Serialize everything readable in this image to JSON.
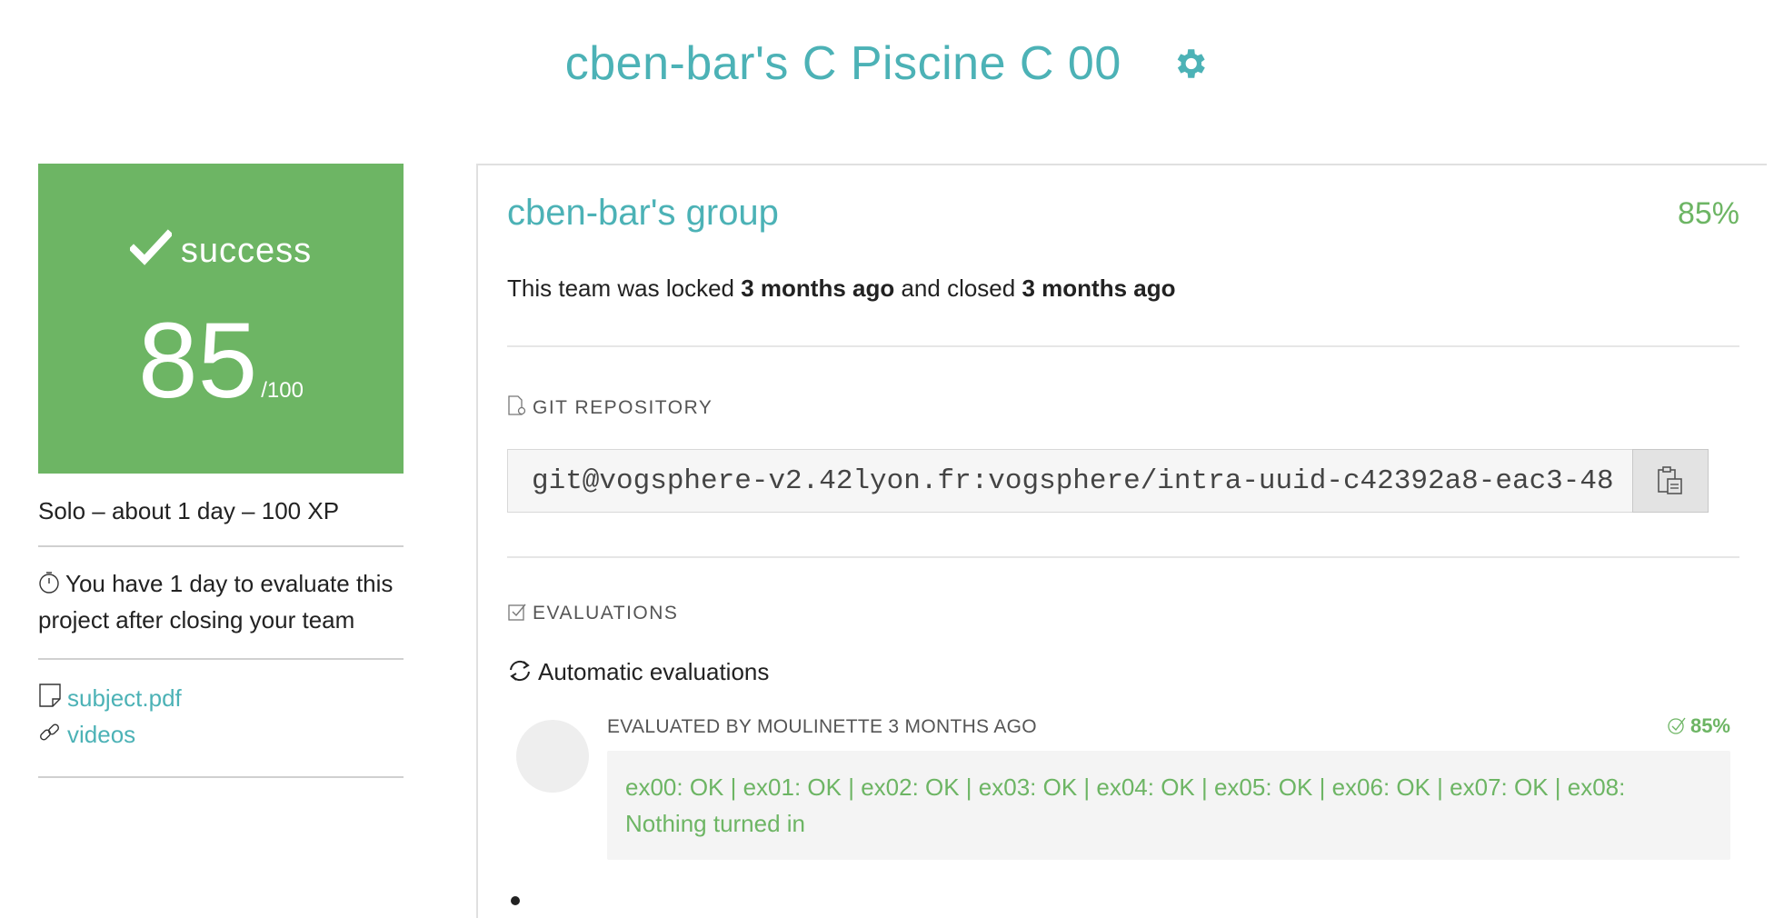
{
  "header": {
    "title": "cben-bar's C Piscine C 00",
    "settings_icon": "gear-icon",
    "accent_color": "#4cb2b6"
  },
  "status_card": {
    "status_icon": "check-icon",
    "status_text": "success",
    "score": "85",
    "score_max": "/100",
    "background_color": "#6db564"
  },
  "project_meta": "Solo – about 1 day – 100 XP",
  "evaluation_note": {
    "icon": "stopwatch-icon",
    "text": "You have 1 day to evaluate this project after closing your team"
  },
  "links": [
    {
      "icon": "document-icon",
      "label": "subject.pdf"
    },
    {
      "icon": "link-icon",
      "label": "videos"
    }
  ],
  "team": {
    "name": "cben-bar's group",
    "percent": "85%",
    "lock_prefix": "This team was locked",
    "locked_ago": "3 months ago",
    "lock_middle": "and closed",
    "closed_ago": "3 months ago"
  },
  "git": {
    "section_icon": "git-file-icon",
    "section_title": "GIT REPOSITORY",
    "url": "git@vogsphere-v2.42lyon.fr:vogsphere/intra-uuid-c42392a8-eac3-48",
    "copy_icon": "clipboard-icon"
  },
  "evaluations": {
    "section_icon": "checkbox-icon",
    "section_title": "EVALUATIONS",
    "auto_icon": "refresh-icon",
    "auto_title": "Automatic evaluations",
    "evaluator_line": "EVALUATED BY MOULINETTE 3 MONTHS AGO",
    "evaluator_percent": "85%",
    "result_text": "ex00: OK | ex01: OK | ex02: OK | ex03: OK | ex04: OK | ex05: OK | ex06: OK | ex07: OK | ex08: Nothing turned in"
  }
}
